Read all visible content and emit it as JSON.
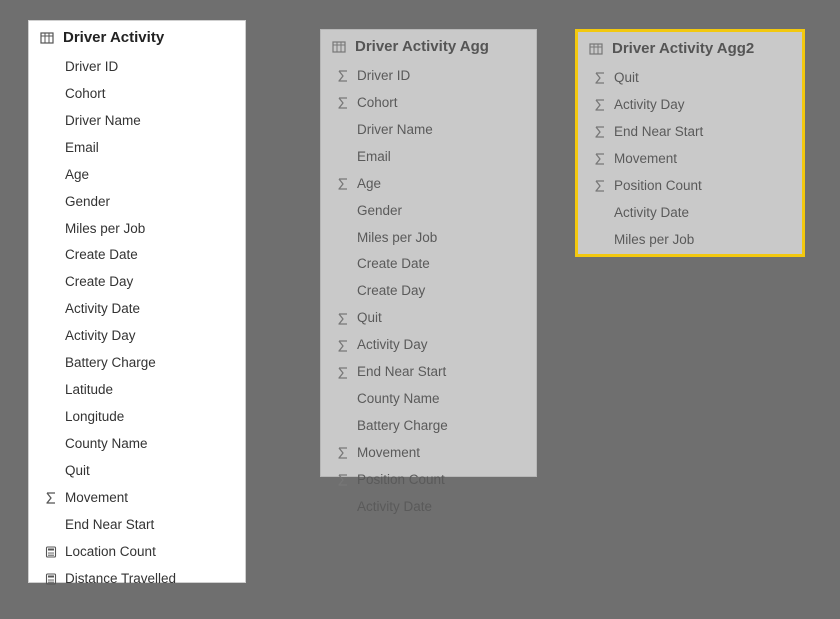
{
  "tables": [
    {
      "id": "card1",
      "header_label": "Driver Activity",
      "style": "normal",
      "fields": [
        {
          "icon": "none",
          "label": "Driver ID"
        },
        {
          "icon": "none",
          "label": "Cohort"
        },
        {
          "icon": "none",
          "label": "Driver Name"
        },
        {
          "icon": "none",
          "label": "Email"
        },
        {
          "icon": "none",
          "label": "Age"
        },
        {
          "icon": "none",
          "label": "Gender"
        },
        {
          "icon": "none",
          "label": "Miles per Job"
        },
        {
          "icon": "none",
          "label": "Create Date"
        },
        {
          "icon": "none",
          "label": "Create Day"
        },
        {
          "icon": "none",
          "label": "Activity Date"
        },
        {
          "icon": "none",
          "label": "Activity Day"
        },
        {
          "icon": "none",
          "label": "Battery Charge"
        },
        {
          "icon": "none",
          "label": "Latitude"
        },
        {
          "icon": "none",
          "label": "Longitude"
        },
        {
          "icon": "none",
          "label": "County Name"
        },
        {
          "icon": "none",
          "label": "Quit"
        },
        {
          "icon": "sigma",
          "label": "Movement"
        },
        {
          "icon": "none",
          "label": "End Near Start"
        },
        {
          "icon": "calc",
          "label": "Location Count"
        },
        {
          "icon": "calc",
          "label": "Distance Travelled"
        }
      ]
    },
    {
      "id": "card2",
      "header_label": "Driver Activity Agg",
      "style": "dim",
      "fields": [
        {
          "icon": "sigma",
          "label": "Driver ID"
        },
        {
          "icon": "sigma",
          "label": "Cohort"
        },
        {
          "icon": "none",
          "label": "Driver Name"
        },
        {
          "icon": "none",
          "label": "Email"
        },
        {
          "icon": "sigma",
          "label": "Age"
        },
        {
          "icon": "none",
          "label": "Gender"
        },
        {
          "icon": "none",
          "label": "Miles per Job"
        },
        {
          "icon": "none",
          "label": "Create Date"
        },
        {
          "icon": "none",
          "label": "Create Day"
        },
        {
          "icon": "sigma",
          "label": "Quit"
        },
        {
          "icon": "sigma",
          "label": "Activity Day"
        },
        {
          "icon": "sigma",
          "label": "End Near Start"
        },
        {
          "icon": "none",
          "label": "County Name"
        },
        {
          "icon": "none",
          "label": "Battery Charge"
        },
        {
          "icon": "sigma",
          "label": "Movement"
        },
        {
          "icon": "sigma",
          "label": "Position Count"
        },
        {
          "icon": "none",
          "label": "Activity Date"
        }
      ]
    },
    {
      "id": "card3",
      "header_label": "Driver Activity Agg2",
      "style": "selected",
      "fields": [
        {
          "icon": "sigma",
          "label": "Quit"
        },
        {
          "icon": "sigma",
          "label": "Activity Day"
        },
        {
          "icon": "sigma",
          "label": "End Near Start"
        },
        {
          "icon": "sigma",
          "label": "Movement"
        },
        {
          "icon": "sigma",
          "label": "Position Count"
        },
        {
          "icon": "none",
          "label": "Activity Date"
        },
        {
          "icon": "none",
          "label": "Miles per Job"
        }
      ]
    }
  ]
}
